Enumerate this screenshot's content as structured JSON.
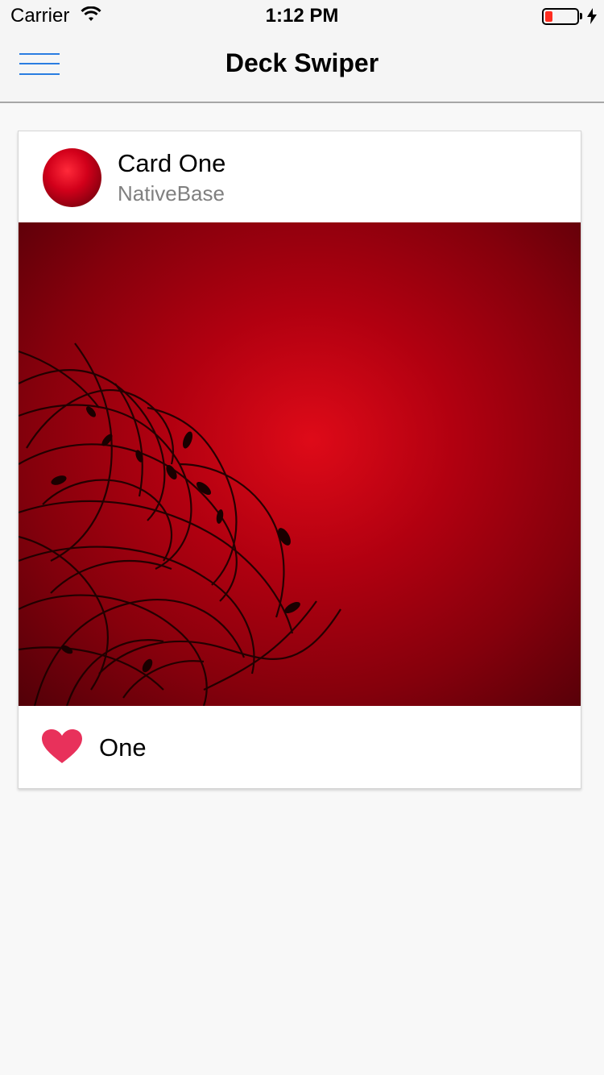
{
  "status_bar": {
    "carrier": "Carrier",
    "time": "1:12 PM",
    "battery_color": "#ff2d20"
  },
  "nav": {
    "title": "Deck Swiper",
    "menu_icon": "hamburger-menu-icon",
    "accent": "#2a7de1"
  },
  "card": {
    "title": "Card One",
    "subtitle": "NativeBase",
    "footer_text": "One",
    "footer_icon": "heart-icon",
    "heart_color": "#e8315b",
    "image_theme": "red-floral-background"
  }
}
